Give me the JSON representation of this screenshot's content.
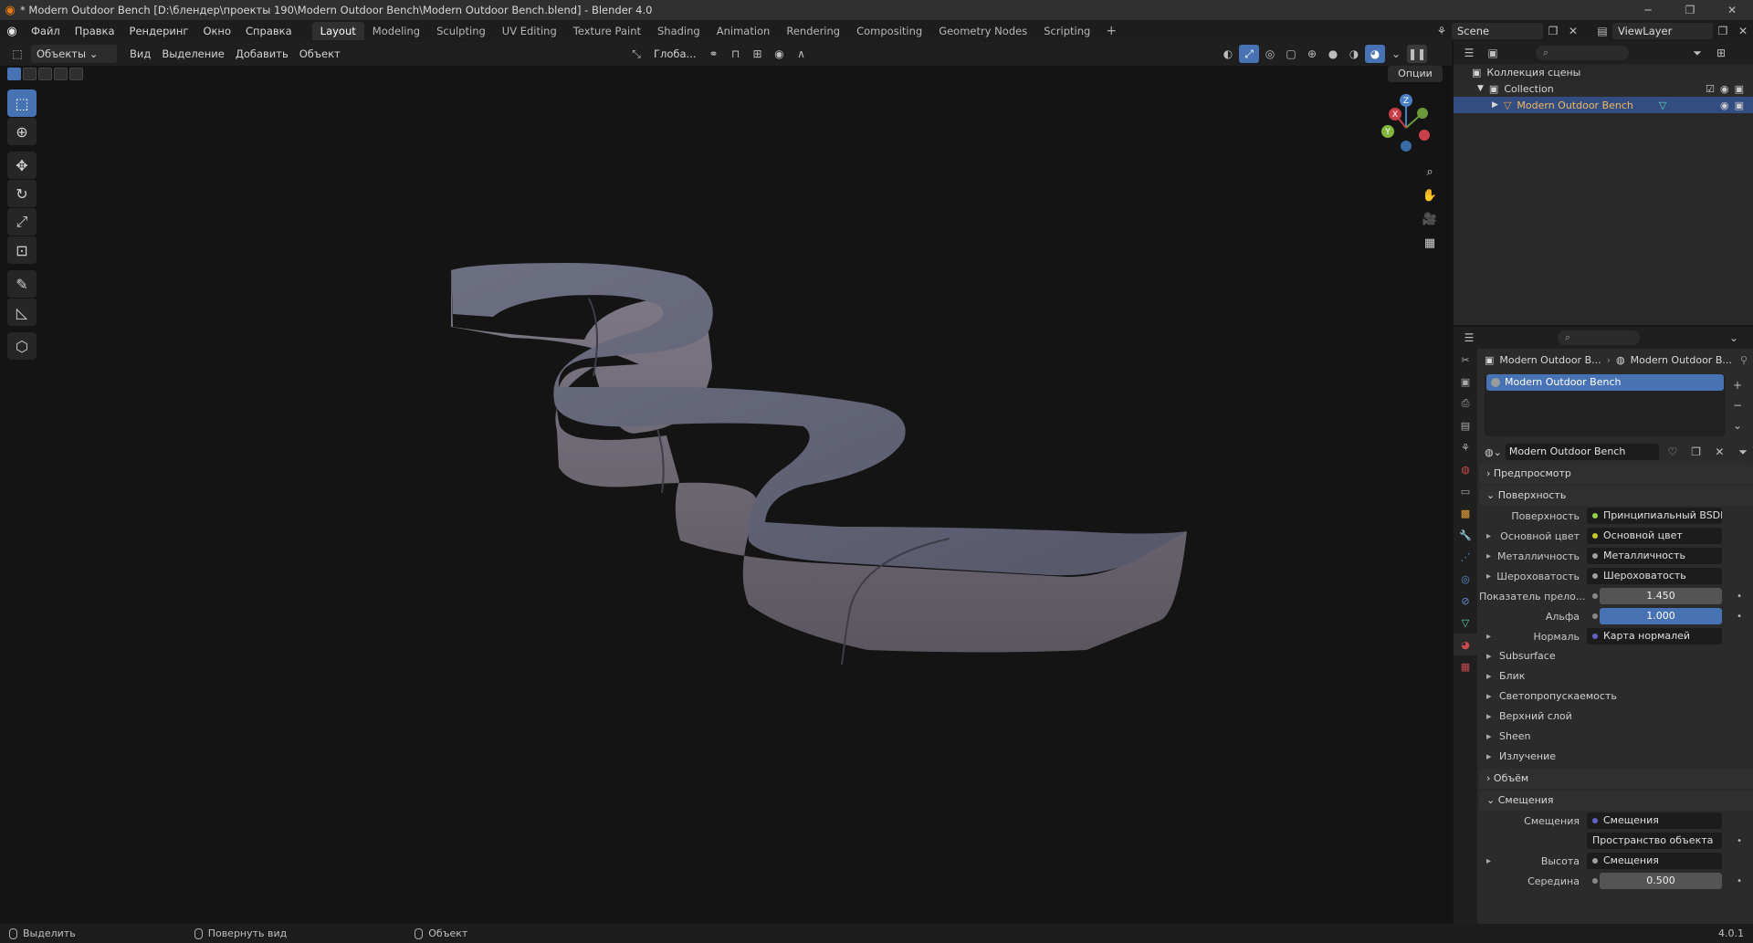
{
  "window": {
    "title": "* Modern Outdoor Bench [D:\\блендер\\проекты 190\\Modern Outdoor Bench\\Modern Outdoor Bench.blend] - Blender 4.0"
  },
  "menu": [
    "Файл",
    "Правка",
    "Рендеринг",
    "Окно",
    "Справка"
  ],
  "workspaces": [
    "Layout",
    "Modeling",
    "Sculpting",
    "UV Editing",
    "Texture Paint",
    "Shading",
    "Animation",
    "Rendering",
    "Compositing",
    "Geometry Nodes",
    "Scripting"
  ],
  "active_workspace": "Layout",
  "scene": {
    "name": "Scene",
    "view_layer": "ViewLayer"
  },
  "viewport_header": {
    "mode": "Объекты",
    "menus": [
      "Вид",
      "Выделение",
      "Добавить",
      "Объект"
    ],
    "transform_orientation": "Глоба...",
    "options": "Опции"
  },
  "outliner": {
    "root": "Коллекция сцены",
    "collection": "Collection",
    "object": "Modern Outdoor Bench"
  },
  "properties": {
    "breadcrumb_object": "Modern Outdoor B...",
    "breadcrumb_material": "Modern Outdoor B...",
    "slot": "Modern Outdoor Bench",
    "material_name": "Modern Outdoor Bench",
    "panels": {
      "preview": "Предпросмотр",
      "surface": "Поверхность",
      "volume": "Объём",
      "displacement": "Смещения"
    },
    "surface_rows": [
      {
        "label": "Поверхность",
        "value": "Принципиальный BSDF",
        "dot": "#8fcf4a"
      },
      {
        "label": "Основной цвет",
        "value": "Основной цвет",
        "dot": "#c7c729",
        "expand": true
      },
      {
        "label": "Металличность",
        "value": "Металличность",
        "dot": "#a0a0a0",
        "expand": true
      },
      {
        "label": "Шероховатость",
        "value": "Шероховатость",
        "dot": "#a0a0a0",
        "expand": true
      }
    ],
    "ior": {
      "label": "Показатель прело...",
      "value": "1.450"
    },
    "alpha": {
      "label": "Альфа",
      "value": "1.000"
    },
    "normal": {
      "label": "Нормаль",
      "value": "Карта нормалей",
      "dot": "#6363c7"
    },
    "subpanels": [
      "Subsurface",
      "Блик",
      "Светопропускаемость",
      "Верхний слой",
      "Sheen",
      "Излучение"
    ],
    "displacement_rows": {
      "disp": {
        "label": "Смещения",
        "value": "Смещения",
        "dot": "#6363c7"
      },
      "space": "Пространство объекта",
      "height": {
        "label": "Высота",
        "value": "Смещения",
        "dot": "#a0a0a0"
      },
      "midlevel": {
        "label": "Середина",
        "value": "0.500"
      }
    }
  },
  "status": {
    "select": "Выделить",
    "rotate": "Повернуть вид",
    "object": "Объект",
    "version": "4.0.1"
  },
  "gizmo": {
    "x": "X",
    "y": "Y",
    "z": "Z"
  },
  "colors": {
    "accent": "#4772b3",
    "selected_row": "#334d80",
    "bench": "#7a7a8c"
  }
}
